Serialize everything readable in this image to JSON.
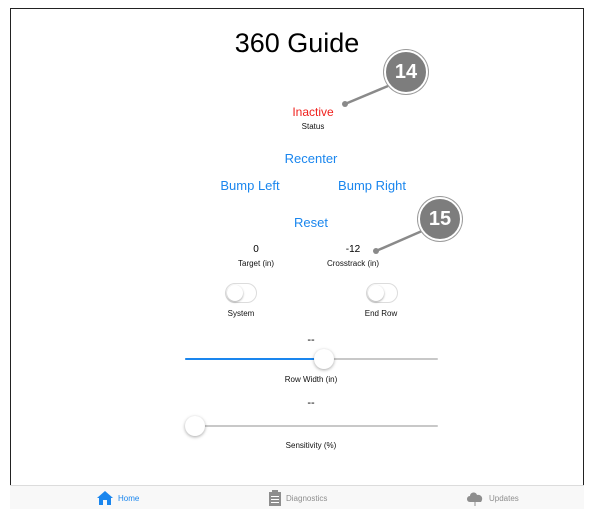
{
  "title": "360 Guide",
  "status": {
    "value": "Inactive",
    "label": "Status"
  },
  "controls": {
    "recenter": "Recenter",
    "bump_left": "Bump Left",
    "bump_right": "Bump Right",
    "reset": "Reset"
  },
  "readouts": {
    "target_value": "0",
    "target_label": "Target (in)",
    "crosstrack_value": "-12",
    "crosstrack_label": "Crosstrack (in)"
  },
  "toggles": {
    "system_label": "System",
    "system_on": false,
    "end_row_label": "End Row",
    "end_row_on": false
  },
  "row_width": {
    "value_text": "--",
    "label": "Row Width (in)",
    "fraction": 0.55
  },
  "sensitivity": {
    "value_text": "--",
    "label": "Sensitivity (%)",
    "fraction": 0.0
  },
  "callouts": {
    "c1": "14",
    "c2": "15"
  },
  "tabs": [
    {
      "label": "Home",
      "icon": "home-icon",
      "active": true
    },
    {
      "label": "Diagnostics",
      "icon": "clipboard-icon",
      "active": false
    },
    {
      "label": "Updates",
      "icon": "cloud-download-icon",
      "active": false
    }
  ],
  "colors": {
    "accent": "#1a86ee",
    "inactive": "#f0201c",
    "callout": "#7d7d7d"
  }
}
